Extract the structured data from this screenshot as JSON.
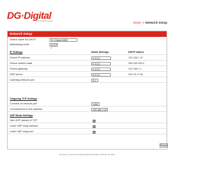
{
  "brand": {
    "logo_text": "DG·Digital",
    "tagline": "by Digital Grapix",
    "accent": "#d9261c"
  },
  "breadcrumb": {
    "home": "Home",
    "separator": "|",
    "current": "Network Setup"
  },
  "panel": {
    "title": "Network Setup"
  },
  "device": {
    "name_label": "Device name for DHCP",
    "name_value": "DC-Digital-8480",
    "addressing_label": "Addressing mode",
    "addressing_value": "DHCP"
  },
  "ip": {
    "section": "IP Settings",
    "static_header": "Static Settings",
    "dhcp_header": "DHCP Values",
    "rows": [
      {
        "label": "Device IP address",
        "static": "0.0.0.0",
        "dhcp": "192.168.1.42"
      },
      {
        "label": "Device subnet mask",
        "static": "0.0.0.0",
        "dhcp": "255.255.255.0"
      },
      {
        "label": "Device gateway",
        "static": "0.0.0.0",
        "dhcp": "192.168.1.1"
      },
      {
        "label": "DNS server",
        "static": "0.0.0.0",
        "dhcp": "209.18.47.60"
      }
    ],
    "listening_label": "Listening network port",
    "listening_value": "23"
  },
  "tcp": {
    "section": "Outgoing TCP Settings",
    "port_label": "Connect on network port",
    "port_value": "1080",
    "address_label": "Connect/send to this address",
    "address_value": "192.168.1.18"
  },
  "udp": {
    "section": "UDP Mode Settings",
    "rows": [
      {
        "label": "Use UDP instead of TCP",
        "checked": "✕"
      },
      {
        "label": "Learn UDP reply address",
        "checked": "✕"
      },
      {
        "label": "Learn UDP reply port",
        "checked": "✕"
      }
    ]
  },
  "submit_label": "Submit",
  "footer": "Firmware Version: DC-Digital Network Module | FW Jan 12 2019"
}
